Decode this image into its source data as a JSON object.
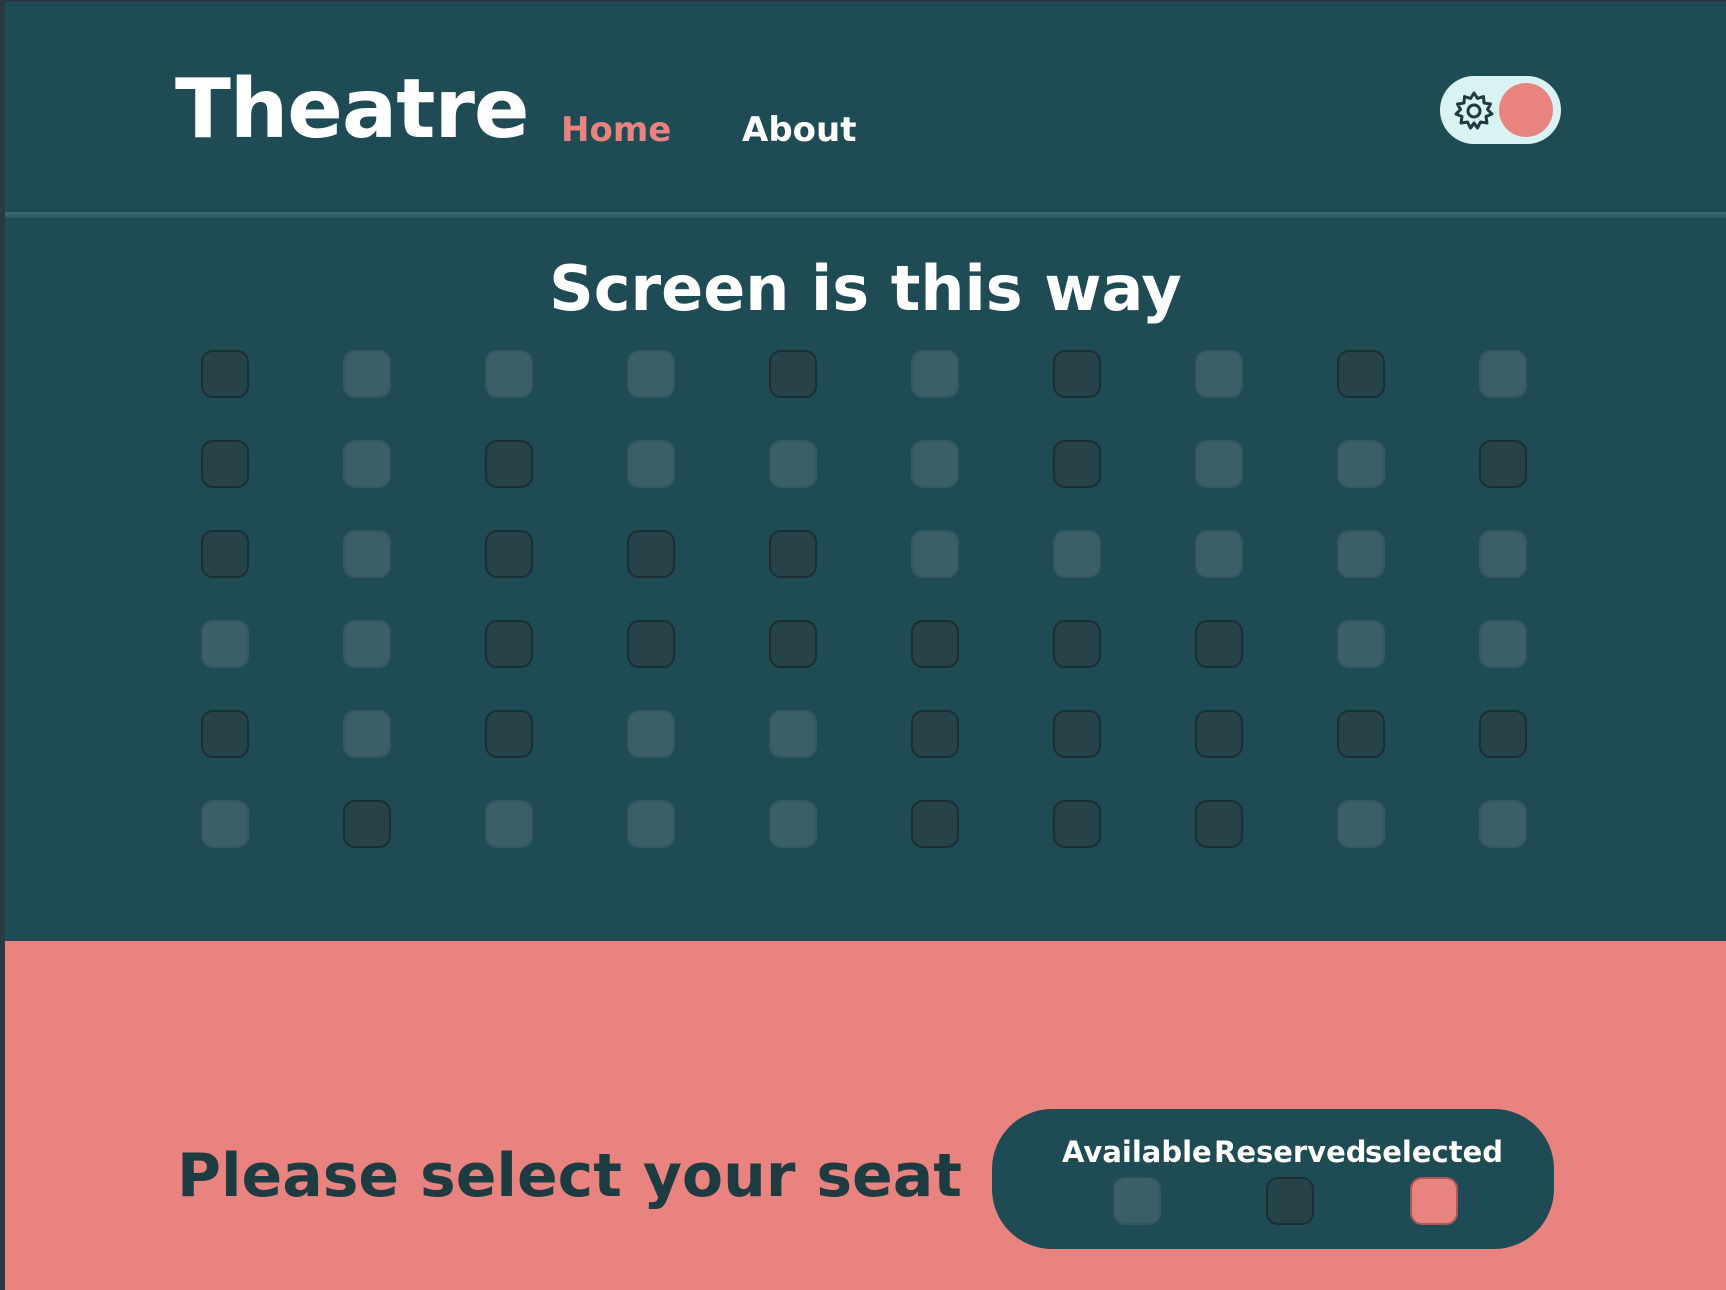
{
  "header": {
    "logo": "Theatre",
    "nav": [
      {
        "label": "Home",
        "active": true
      },
      {
        "label": "About",
        "active": false
      }
    ],
    "theme_toggle": {
      "icon": "gear-icon",
      "state": "on"
    }
  },
  "seating": {
    "title": "Screen is this way",
    "rows": [
      [
        "reserved",
        "available",
        "available",
        "available",
        "reserved",
        "available",
        "reserved",
        "available",
        "reserved",
        "available"
      ],
      [
        "reserved",
        "available",
        "reserved",
        "available",
        "available",
        "available",
        "reserved",
        "available",
        "available",
        "reserved"
      ],
      [
        "reserved",
        "available",
        "reserved",
        "reserved",
        "reserved",
        "available",
        "available",
        "available",
        "available",
        "available"
      ],
      [
        "available",
        "available",
        "reserved",
        "reserved",
        "reserved",
        "reserved",
        "reserved",
        "reserved",
        "available",
        "available"
      ],
      [
        "reserved",
        "available",
        "reserved",
        "available",
        "available",
        "reserved",
        "reserved",
        "reserved",
        "reserved",
        "reserved"
      ],
      [
        "available",
        "reserved",
        "available",
        "available",
        "available",
        "reserved",
        "reserved",
        "reserved",
        "available",
        "available"
      ]
    ]
  },
  "footer": {
    "title": "Please select your seat",
    "legend": [
      {
        "label": "Available",
        "status": "available"
      },
      {
        "label": "Reserved",
        "status": "reserved"
      },
      {
        "label": "selected",
        "status": "selected"
      }
    ]
  },
  "colors": {
    "background": "#1f4b55",
    "accent": "#e8837f",
    "seat_available": "#3a5f66",
    "seat_reserved": "#27434a",
    "seat_selected": "#e8837f"
  }
}
